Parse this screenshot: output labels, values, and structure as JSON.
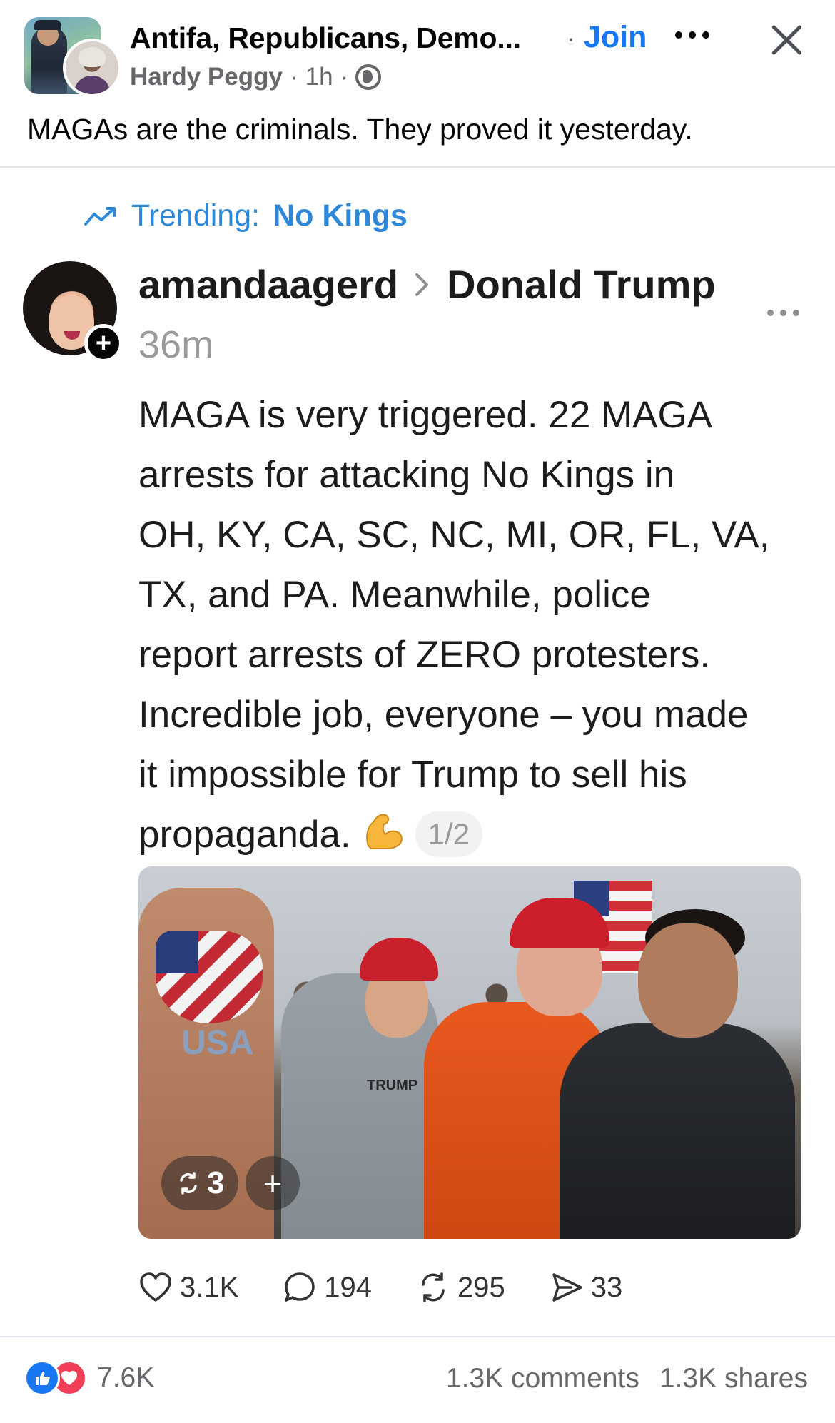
{
  "group_post": {
    "group_name": "Antifa, Republicans, Demo...",
    "separator": "·",
    "join_label": "Join",
    "author": "Hardy Peggy",
    "time": "1h",
    "meta_sep": "·",
    "text": "MAGAs are the criminals. They proved it yesterday."
  },
  "threads_post": {
    "trending_prefix": "Trending:",
    "trending_topic": "No Kings",
    "username": "amandaagerd",
    "reply_to": "Donald Trump",
    "time": "36m",
    "body_lines": [
      "MAGA is very triggered. 22 MAGA",
      "arrests for attacking No Kings in",
      "OH, KY, CA, SC, NC, MI, OR, FL, VA,",
      "TX, and PA. Meanwhile, police",
      "report arrests of ZERO protesters.",
      "Incredible job, everyone – you made",
      "it impossible for Trump to sell his",
      "propaganda."
    ],
    "page_indicator": "1/2",
    "photo": {
      "shirt_text": "TRUMP",
      "body_paint": "USA",
      "repost_count": "3",
      "add_symbol": "+"
    },
    "actions": {
      "likes": "3.1K",
      "comments": "194",
      "reposts": "295",
      "shares": "33"
    }
  },
  "footer": {
    "reaction_count": "7.6K",
    "comments": "1.3K comments",
    "shares": "1.3K shares"
  },
  "colors": {
    "facebook_blue": "#1877f2",
    "trending_blue": "#2d88d9",
    "love_red": "#f33e58",
    "secondary_text": "#65676b"
  },
  "icons": [
    "more-icon",
    "close-icon",
    "globe-icon",
    "trend-icon",
    "chevron-right-icon",
    "flexed-biceps-icon",
    "heart-icon",
    "comment-icon",
    "repost-icon",
    "send-icon",
    "like-reaction-icon",
    "love-reaction-icon"
  ]
}
